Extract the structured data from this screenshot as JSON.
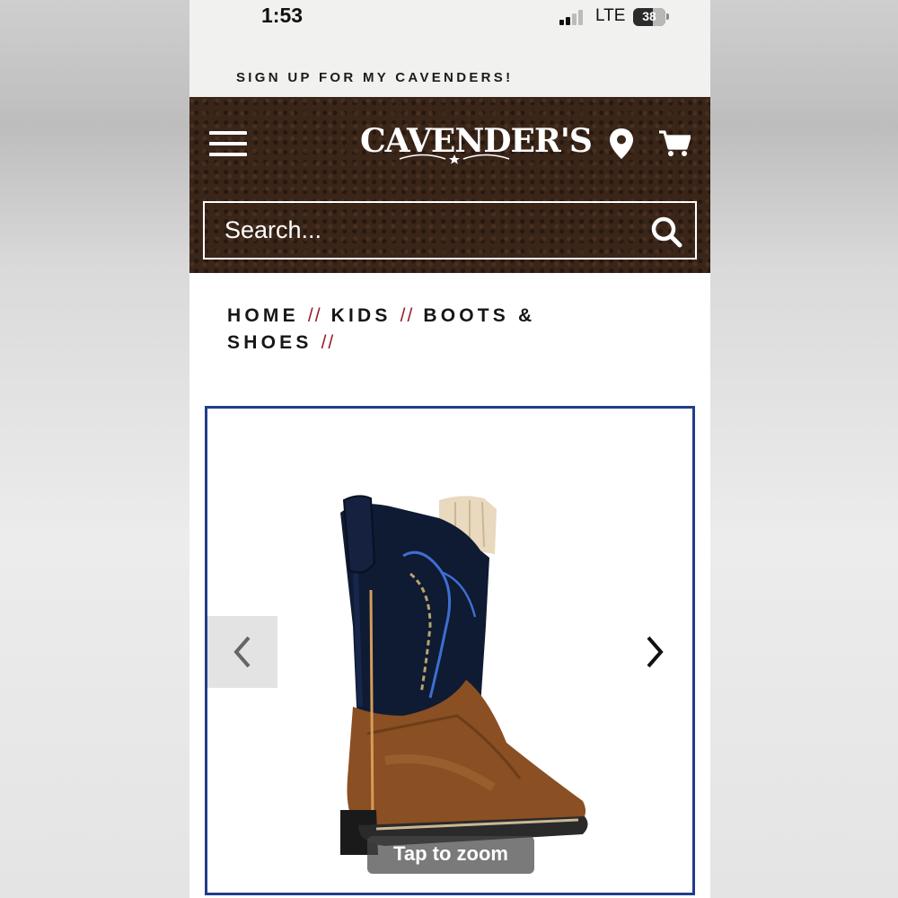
{
  "status_bar": {
    "time": "1:53",
    "network": "LTE",
    "battery": "38"
  },
  "banner": {
    "signup_text": "SIGN UP FOR MY CAVENDERS!"
  },
  "header": {
    "logo_text": "CAVENDER'S",
    "search_placeholder": "Search...",
    "icons": [
      "menu-icon",
      "location-pin-icon",
      "cart-icon",
      "search-icon"
    ]
  },
  "breadcrumb": {
    "items": [
      "HOME",
      "KIDS",
      "BOOTS & SHOES"
    ],
    "separator": "//",
    "separator_color": "#9c1a2c"
  },
  "product_gallery": {
    "zoom_hint": "Tap to zoom",
    "border_color": "#1f3f8a",
    "prev_icon": "chevron-left-icon",
    "next_icon": "chevron-right-icon"
  },
  "colors": {
    "header_bg": "#3a2519",
    "page_bg": "#ffffff",
    "status_bg": "#f1f1f0"
  }
}
